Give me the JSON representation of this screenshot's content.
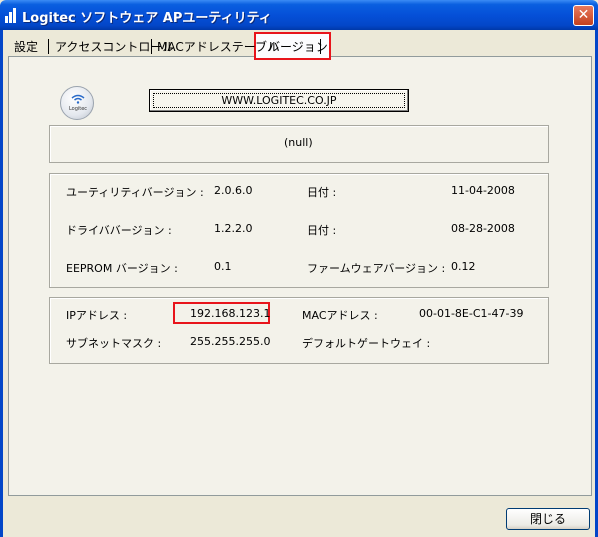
{
  "window": {
    "title": "Logitec ソフトウェア APユーティリティ",
    "close_glyph": "✕"
  },
  "tabs": [
    {
      "label": "設定"
    },
    {
      "label": "アクセスコントロール"
    },
    {
      "label": "MACアドレステーブル"
    },
    {
      "label": "バージョン",
      "active": true
    }
  ],
  "logo": {
    "text": "Logitec"
  },
  "url_button": {
    "label": "WWW.LOGITEC.CO.JP"
  },
  "null_text": "(null)",
  "versions": {
    "utility_label": "ユーティリティバージョン :",
    "utility_value": "2.0.6.0",
    "utility_date_label": "日付 :",
    "utility_date": "11-04-2008",
    "driver_label": "ドライババージョン :",
    "driver_value": "1.2.2.0",
    "driver_date_label": "日付 :",
    "driver_date": "08-28-2008",
    "eeprom_label": "EEPROM バージョン :",
    "eeprom_value": "0.1",
    "firmware_label": "ファームウェアバージョン :",
    "firmware_value": "0.12"
  },
  "network": {
    "ip_label": "IPアドレス :",
    "ip_value": "192.168.123.1",
    "mac_label": "MACアドレス :",
    "mac_value": "00-01-8E-C1-47-39",
    "subnet_label": "サブネットマスク :",
    "subnet_value": "255.255.255.0",
    "gateway_label": "デフォルトゲートウェイ :",
    "gateway_value": ""
  },
  "footer": {
    "close_label": "閉じる"
  },
  "colors": {
    "highlight": "#E8141B",
    "titlebar": "#0550D8"
  }
}
